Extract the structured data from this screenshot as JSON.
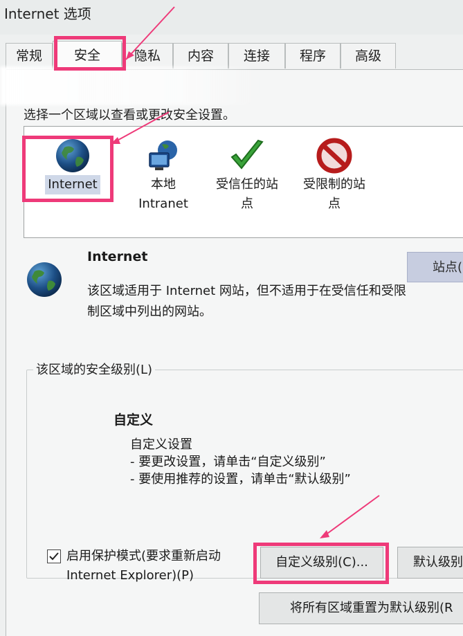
{
  "window": {
    "title": "Internet 选项"
  },
  "tabs": [
    {
      "label": "常规"
    },
    {
      "label": "安全"
    },
    {
      "label": "隐私"
    },
    {
      "label": "内容"
    },
    {
      "label": "连接"
    },
    {
      "label": "程序"
    },
    {
      "label": "高级"
    }
  ],
  "active_tab": "安全",
  "zone_prompt": "选择一个区域以查看或更改安全设置。",
  "zones": [
    {
      "label": "Internet",
      "icon": "globe-icon",
      "selected": true
    },
    {
      "label_line1": "本地",
      "label_line2": "Intranet",
      "icon": "local-intranet-icon"
    },
    {
      "label_line1": "受信任的站",
      "label_line2": "点",
      "icon": "green-check-icon"
    },
    {
      "label_line1": "受限制的站",
      "label_line2": "点",
      "icon": "no-entry-icon"
    }
  ],
  "zone_info": {
    "name": "Internet",
    "description": "该区域适用于 Internet 网站，但不适用于在受信任和受限制区域中列出的网站。",
    "sites_button": "站点("
  },
  "security_level": {
    "legend": "该区域的安全级别(L)",
    "level_name": "自定义",
    "line1": "自定义设置",
    "line2": "- 要更改设置，请单击“自定义级别”",
    "line3": "- 要使用推荐的设置，请单击“默认级别”"
  },
  "protected_mode": {
    "checked": true,
    "line1": "启用保护模式(要求重新启动",
    "line2": "Internet Explorer)(P)"
  },
  "buttons": {
    "custom_level": "自定义级别(C)...",
    "default_level": "默认级别",
    "reset_all": "将所有区域重置为默认级别(R"
  },
  "colors": {
    "highlight": "#ee3a79",
    "selection": "#cfd8e8",
    "check_green": "#3aa33a",
    "restricted_red": "#b71c1c"
  }
}
